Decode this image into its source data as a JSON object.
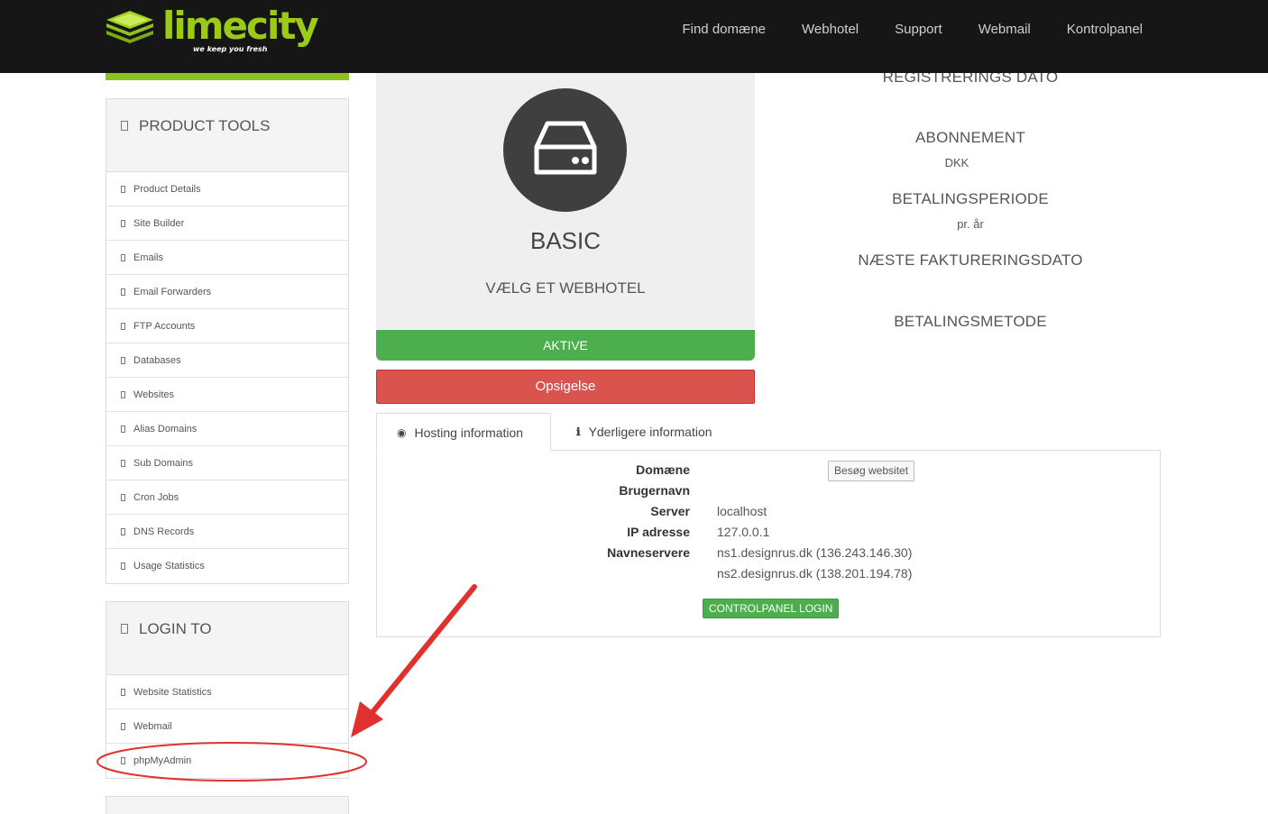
{
  "header": {
    "logo_text": "limecity",
    "logo_tagline": "we keep you fresh",
    "nav": [
      "Find domæne",
      "Webhotel",
      "Support",
      "Webmail",
      "Kontrolpanel"
    ]
  },
  "sidebar": {
    "product_tools": {
      "title": "PRODUCT TOOLS",
      "items": [
        "Product Details",
        "Site Builder",
        "Emails",
        "Email Forwarders",
        "FTP Accounts",
        "Databases",
        "Websites",
        "Alias Domains",
        "Sub Domains",
        "Cron Jobs",
        "DNS Records",
        "Usage Statistics"
      ]
    },
    "login_to": {
      "title": "LOGIN TO",
      "items": [
        "Website Statistics",
        "Webmail",
        "phpMyAdmin"
      ]
    }
  },
  "product": {
    "name": "BASIC",
    "subtitle": "VÆLG ET WEBHOTEL",
    "status": "AKTIVE",
    "cancel_label": "Opsigelse",
    "icon": "hard-drive-icon"
  },
  "details": {
    "registration_label": "REGISTRERINGS DATO",
    "subscription_label": "ABONNEMENT",
    "subscription_value": "DKK",
    "billing_period_label": "BETALINGSPERIODE",
    "billing_period_value": "pr. år",
    "next_invoice_label": "NÆSTE FAKTURERINGSDATO",
    "payment_method_label": "BETALINGSMETODE"
  },
  "tabs": {
    "hosting": "Hosting information",
    "more": "Yderligere information"
  },
  "hosting": {
    "domain_label": "Domæne",
    "visit_button": "Besøg websitet",
    "username_label": "Brugernavn",
    "server_label": "Server",
    "server_value": "localhost",
    "ip_label": "IP adresse",
    "ip_value": "127.0.0.1",
    "nameservers_label": "Navneservere",
    "ns1": "ns1.designrus.dk (136.243.146.30)",
    "ns2": "ns2.designrus.dk (138.201.194.78)",
    "cp_login": "CONTROLPANEL LOGIN"
  },
  "colors": {
    "brand_lime": "#8dc21f",
    "header_bg": "#161616",
    "active_green": "#4cae4c",
    "cancel_red": "#d9534f",
    "annotation_red": "#e0312f"
  }
}
